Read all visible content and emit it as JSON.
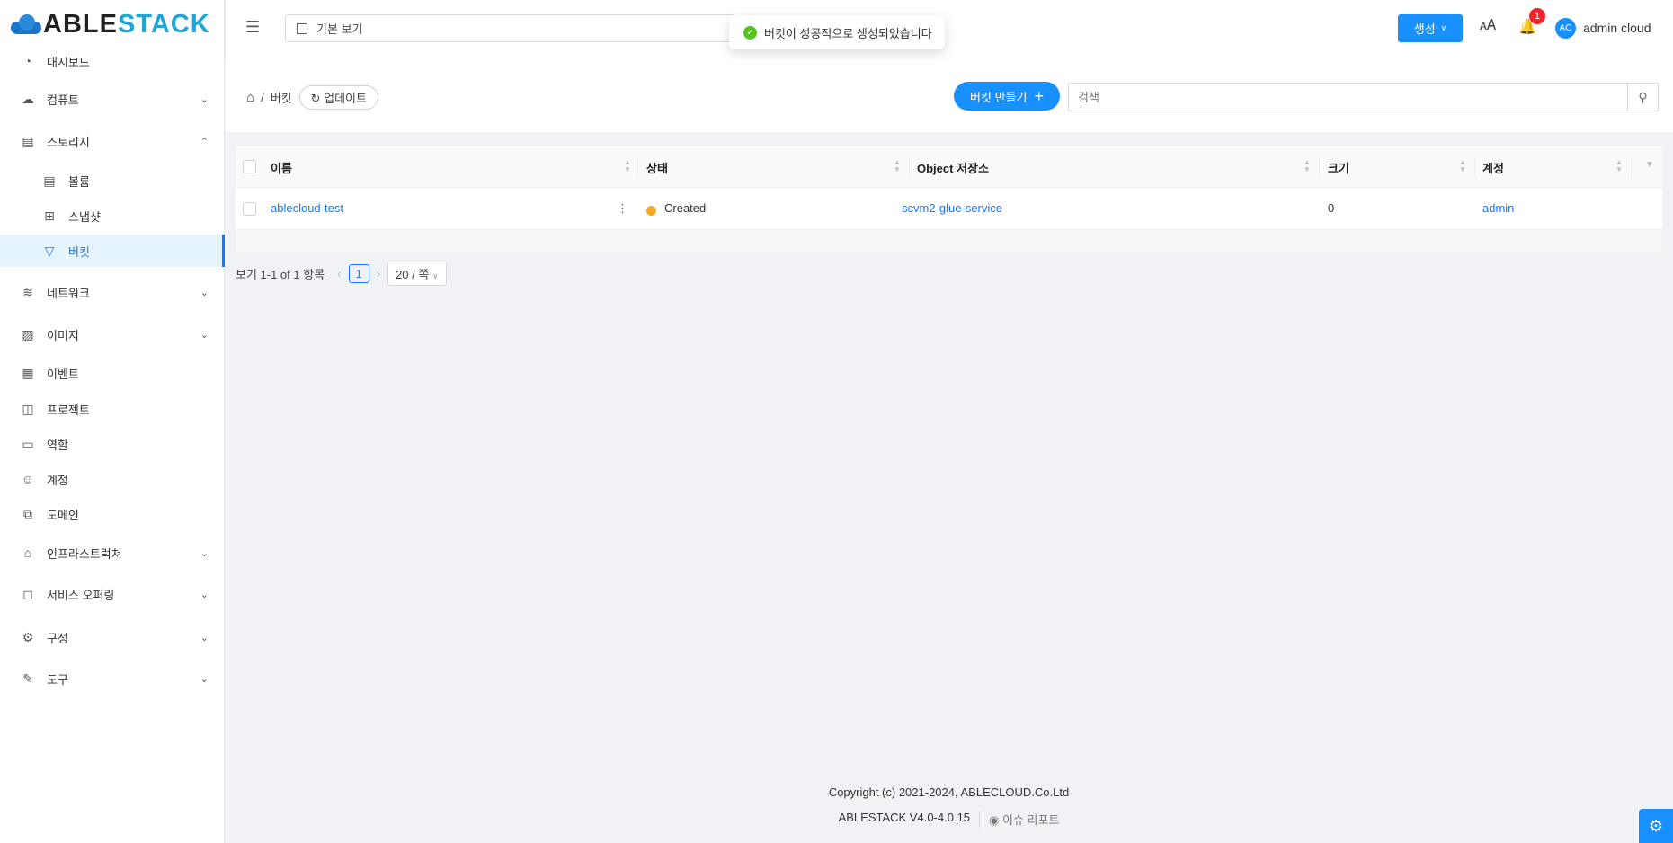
{
  "brand": {
    "logo_part1": "ABLE",
    "logo_part2": "STACK"
  },
  "sidebar": {
    "items": [
      {
        "label": "대시보드",
        "icon": "dashboard-icon"
      },
      {
        "label": "컴퓨트",
        "icon": "cloud-icon",
        "expandable": true
      },
      {
        "label": "스토리지",
        "icon": "storage-icon",
        "expandable": true,
        "expanded": true
      },
      {
        "label": "볼륨",
        "icon": "volume-icon",
        "sub": true
      },
      {
        "label": "스냅샷",
        "icon": "snapshot-icon",
        "sub": true
      },
      {
        "label": "버킷",
        "icon": "bucket-icon",
        "sub": true,
        "active": true
      },
      {
        "label": "네트워크",
        "icon": "wifi-icon",
        "expandable": true
      },
      {
        "label": "이미지",
        "icon": "image-icon",
        "expandable": true
      },
      {
        "label": "이벤트",
        "icon": "calendar-icon"
      },
      {
        "label": "프로젝트",
        "icon": "project-icon"
      },
      {
        "label": "역할",
        "icon": "id-card-icon"
      },
      {
        "label": "계정",
        "icon": "users-icon"
      },
      {
        "label": "도메인",
        "icon": "domain-icon"
      },
      {
        "label": "인프라스트럭쳐",
        "icon": "bank-icon",
        "expandable": true
      },
      {
        "label": "서비스 오퍼링",
        "icon": "shopping-bag-icon",
        "expandable": true
      },
      {
        "label": "구성",
        "icon": "gear-icon",
        "expandable": true
      },
      {
        "label": "도구",
        "icon": "wrench-icon",
        "expandable": true
      }
    ]
  },
  "header": {
    "view_select": "기본 보기",
    "create_label": "생성",
    "notification_count": "1",
    "avatar_initials": "AC",
    "user_name": "admin cloud"
  },
  "toast": {
    "message": "버킷이 성공적으로 생성되었습니다"
  },
  "breadcrumb": {
    "separator": "/",
    "current": "버킷",
    "refresh_label": "업데이트"
  },
  "actions": {
    "create_bucket_label": "버킷 만들기",
    "search_placeholder": "검색"
  },
  "table": {
    "columns": [
      "이름",
      "상태",
      "Object 저장소",
      "크기",
      "계정"
    ],
    "rows": [
      {
        "name": "ablecloud-test",
        "status": "Created",
        "object_store": "scvm2-glue-service",
        "size": "0",
        "account": "admin"
      }
    ],
    "status_color": "#f5a623"
  },
  "pagination": {
    "summary": "보기 1-1 of 1 항목",
    "current_page": "1",
    "page_size": "20 / 쪽"
  },
  "footer": {
    "copyright": "Copyright (c) 2021-2024, ABLECLOUD.Co.Ltd",
    "version": "ABLESTACK V4.0-4.0.15",
    "issue_report": "이슈 리포트"
  }
}
